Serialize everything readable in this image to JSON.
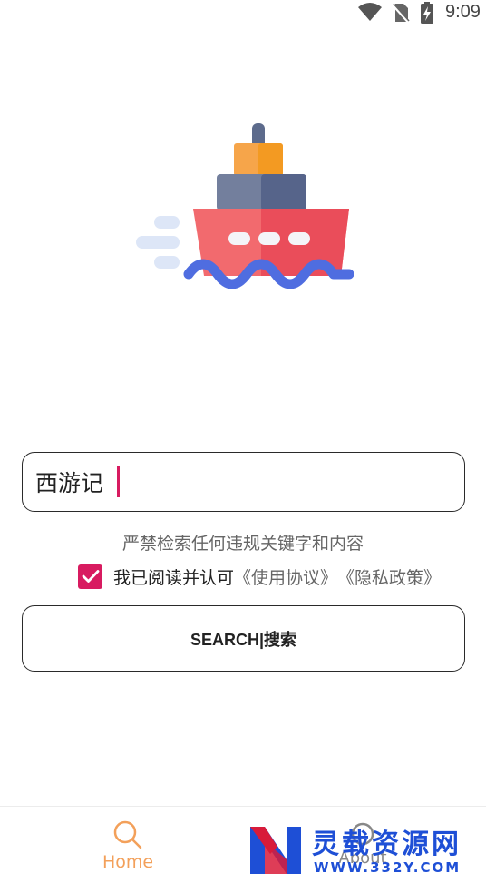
{
  "status_bar": {
    "time": "9:09"
  },
  "search": {
    "value": "西游记"
  },
  "notice": "严禁检索任何违规关键字和内容",
  "agreement": {
    "checked": true,
    "text": "我已阅读并认可",
    "terms_link": "《使用协议》",
    "privacy_link": "《隐私政策》"
  },
  "search_button": {
    "label": "SEARCH|搜索"
  },
  "nav": {
    "home": "Home",
    "about": "About"
  },
  "watermark": {
    "title": "灵载资源网",
    "url": "WWW.332Y.COM"
  },
  "colors": {
    "accent": "#d81b60",
    "home_active": "#f3a05a",
    "watermark": "#1e4fd6"
  }
}
